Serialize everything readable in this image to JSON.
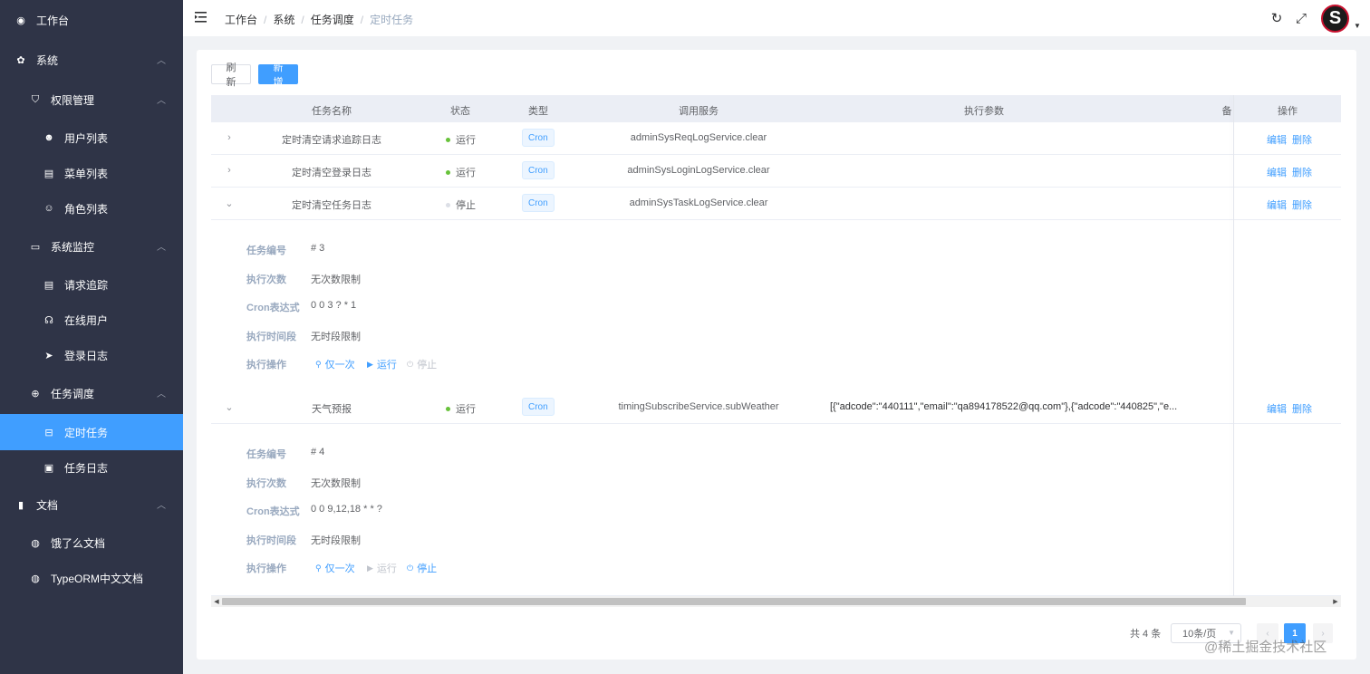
{
  "sidebar": {
    "items": [
      {
        "label": "工作台",
        "icon": "dashboard-icon"
      },
      {
        "label": "系统",
        "icon": "gear-icon"
      },
      {
        "label": "权限管理",
        "icon": "shield-icon"
      },
      {
        "label": "用户列表",
        "icon": "users-icon"
      },
      {
        "label": "菜单列表",
        "icon": "menu-list-icon"
      },
      {
        "label": "角色列表",
        "icon": "role-icon"
      },
      {
        "label": "系统监控",
        "icon": "monitor-icon"
      },
      {
        "label": "请求追踪",
        "icon": "document-icon"
      },
      {
        "label": "在线用户",
        "icon": "online-user-icon"
      },
      {
        "label": "登录日志",
        "icon": "send-icon"
      },
      {
        "label": "任务调度",
        "icon": "schedule-icon"
      },
      {
        "label": "定时任务",
        "icon": "timer-icon"
      },
      {
        "label": "任务日志",
        "icon": "log-icon"
      },
      {
        "label": "文档",
        "icon": "file-icon"
      },
      {
        "label": "饿了么文档",
        "icon": "globe-icon"
      },
      {
        "label": "TypeORM中文文档",
        "icon": "globe-icon"
      }
    ]
  },
  "header": {
    "breadcrumb": [
      "工作台",
      "系统",
      "任务调度",
      "定时任务"
    ],
    "avatar_letter": "S"
  },
  "toolbar": {
    "refresh_label": "刷新",
    "add_label": "新增"
  },
  "table": {
    "columns": [
      "任务名称",
      "状态",
      "类型",
      "调用服务",
      "执行参数",
      "备",
      "操作"
    ],
    "rows": [
      {
        "name": "定时清空请求追踪日志",
        "status": "运行",
        "type": "Cron",
        "service": "adminSysReqLogService.clear",
        "params": "",
        "edit": "编辑",
        "delete": "删除"
      },
      {
        "name": "定时清空登录日志",
        "status": "运行",
        "type": "Cron",
        "service": "adminSysLoginLogService.clear",
        "params": "",
        "edit": "编辑",
        "delete": "删除"
      },
      {
        "name": "定时清空任务日志",
        "status": "停止",
        "type": "Cron",
        "service": "adminSysTaskLogService.clear",
        "params": "",
        "edit": "编辑",
        "delete": "删除"
      },
      {
        "name": "天气预报",
        "status": "运行",
        "type": "Cron",
        "service": "timingSubscribeService.subWeather",
        "params": "[{\"adcode\":\"440111\",\"email\":\"qa894178522@qq.com\"},{\"adcode\":\"440825\",\"e...",
        "edit": "编辑",
        "delete": "删除"
      }
    ],
    "colors": {
      "running": "#67c23a",
      "stopped": "#c0c4cc"
    }
  },
  "details": [
    {
      "labels": [
        "任务编号",
        "执行次数",
        "Cron表达式",
        "执行时间段",
        "执行操作"
      ],
      "values": [
        "# 3",
        "无次数限制",
        "0 0 3 ? * 1",
        "无时段限制"
      ],
      "actions": {
        "once": "仅一次",
        "run": "运行",
        "stop": "停止"
      }
    },
    {
      "labels": [
        "任务编号",
        "执行次数",
        "Cron表达式",
        "执行时间段",
        "执行操作"
      ],
      "values": [
        "# 4",
        "无次数限制",
        "0 0 9,12,18 * * ?",
        "无时段限制"
      ],
      "actions": {
        "once": "仅一次",
        "run": "运行",
        "stop": "停止"
      }
    }
  ],
  "pagination": {
    "total": "共 4 条",
    "page_size": "10条/页",
    "current_page": "1"
  },
  "watermark": "@稀土掘金技术社区"
}
